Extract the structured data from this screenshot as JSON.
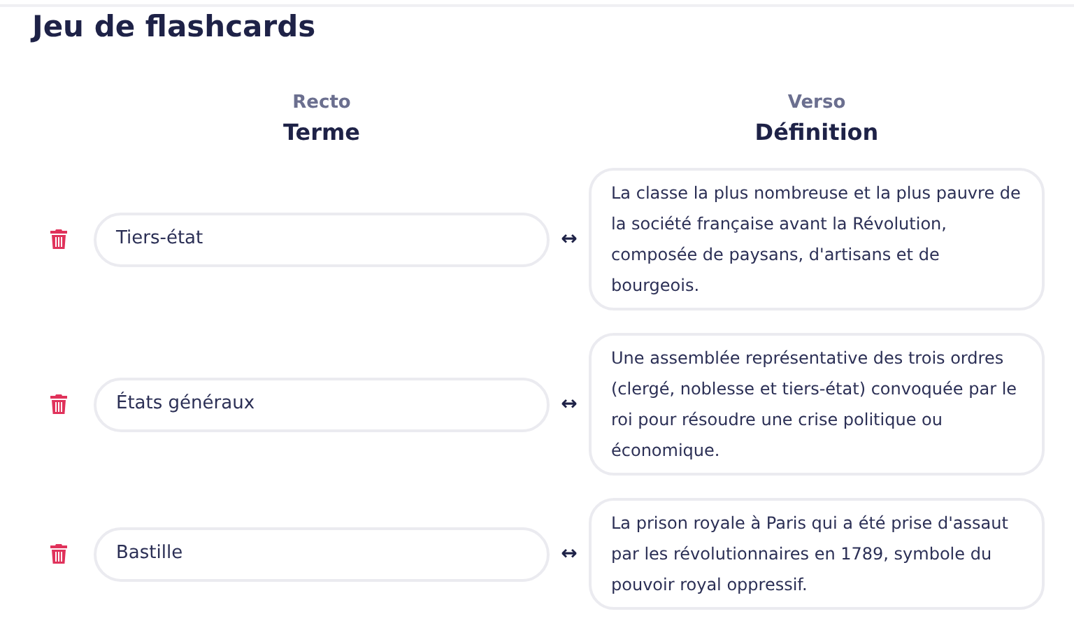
{
  "title": "Jeu de flashcards",
  "columns": [
    {
      "side": "Recto",
      "heading": "Terme"
    },
    {
      "side": "Verso",
      "heading": "Définition"
    }
  ],
  "cards": [
    {
      "term": "Tiers-état",
      "link": "↔",
      "definition": "La classe la plus nombreuse et la plus pauvre de la société française avant la Révolution, composée de paysans, d'artisans et de bourgeois."
    },
    {
      "term": "États généraux",
      "link": "↔",
      "definition": "Une assemblée représentative des trois ordres (clergé, noblesse et tiers-état) convoquée par le roi pour résoudre une crise politique ou économique."
    },
    {
      "term": "Bastille",
      "link": "↔",
      "definition": "La prison royale à Paris qui a été prise d'assaut par les révolutionnaires en 1789, symbole du pouvoir royal oppressif."
    }
  ]
}
